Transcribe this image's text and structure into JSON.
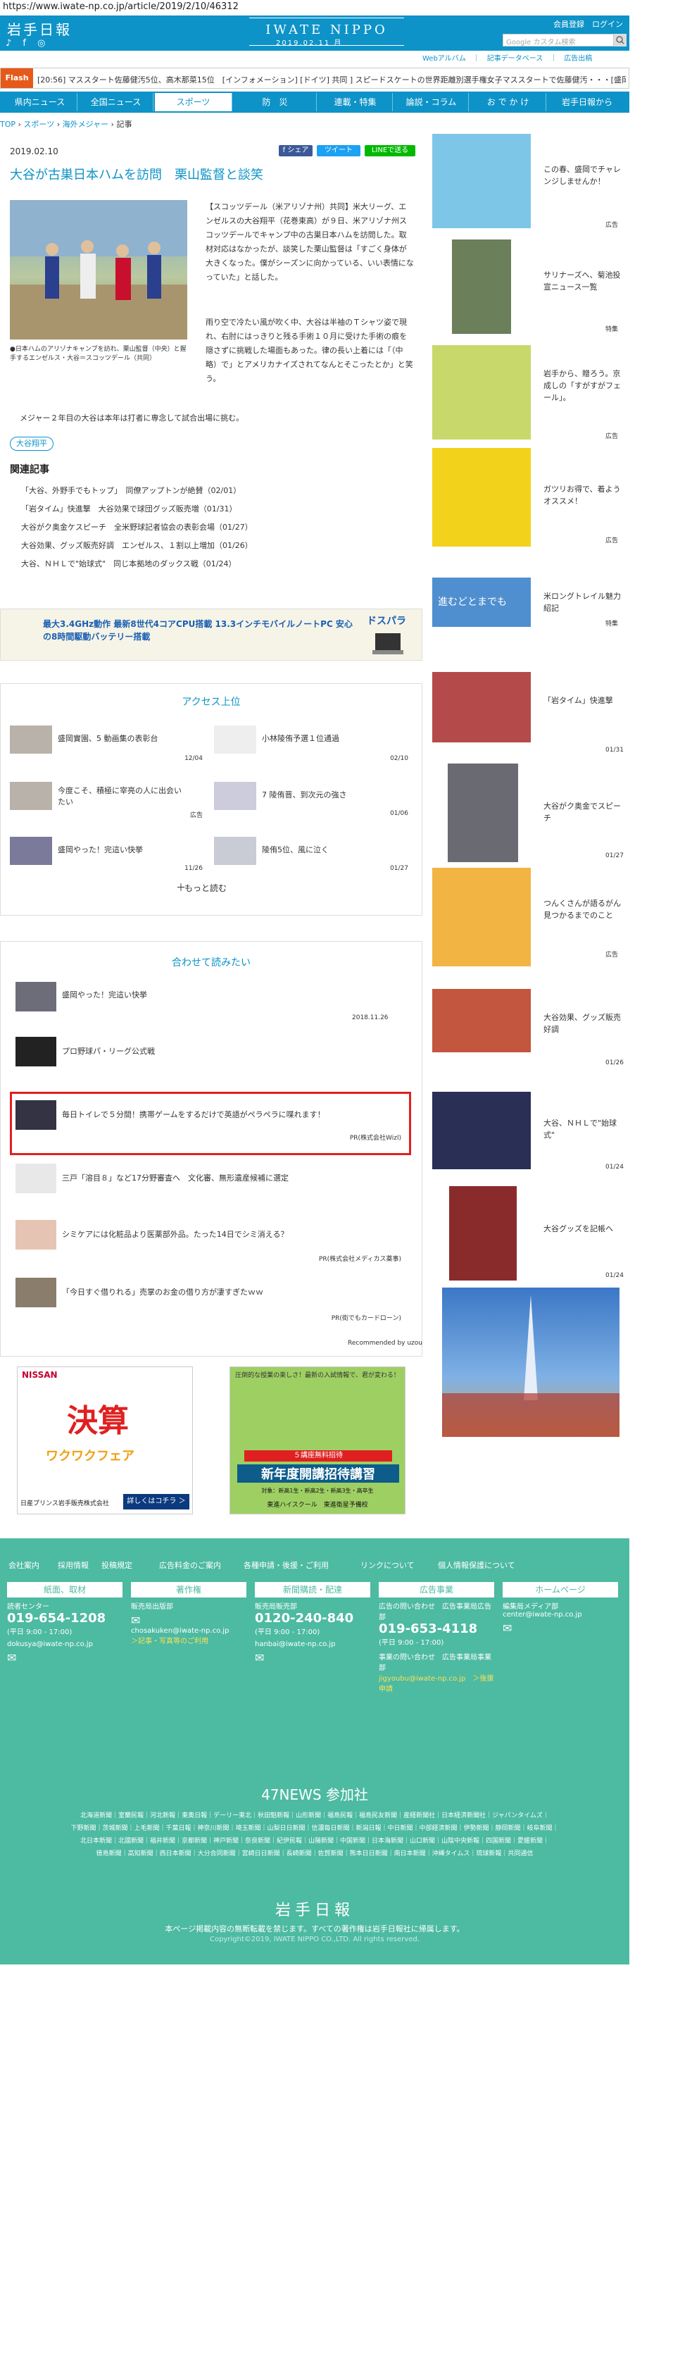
{
  "browser": {
    "url": "https://www.iwate-np.co.jp/article/2019/2/10/46312"
  },
  "header": {
    "logo": "岩手日報",
    "sns": "♪ f ◎",
    "brand": "IWATE NIPPO",
    "date": "2019.02.11 月",
    "links": "会員登録　ログイン",
    "search_placeholder": "Google カスタム検索",
    "webalbum": "Webアルバム　｜　記事データベース　｜　広告出稿"
  },
  "flash": {
    "label": "Flash",
    "text": "[20:56] マススタート佐藤健汚5位、高木那菜15位　[インフォメーション] [ドイツ] 共同 ] スピードスケートの世界距離別選手権女子マススタートで佐藤健汚・・・[盛岡・雫石] 盛岡市・・・"
  },
  "nav": [
    "県内ニュース",
    "全国ニュース",
    "スポーツ",
    "防　災",
    "連載・特集",
    "論説・コラム",
    "お で か け",
    "岩手日報から"
  ],
  "breadcrumb": {
    "top": "TOP",
    "sep": " › ",
    "sports": "スポーツ",
    "abroad": "海外メジャー",
    "current": "記事"
  },
  "article": {
    "date": "2019.02.10",
    "share_fb": "f シェア",
    "share_tw": "ツイート",
    "share_line": "LINEで送る",
    "headline": "大谷が古巣日本ハムを訪問　栗山監督と談笑",
    "caption": "●日本ハムのアリゾナキャンプを訪れ、栗山監督（中央）と握手するエンゼルス・大谷＝スコッツデール（共同）",
    "p1": "【スコッツデール（米アリゾナ州）共同】米大リーグ、エンゼルスの大谷翔平（花巻東高）が９日、米アリゾナ州スコッツデールでキャンプ中の古巣日本ハムを訪問した。取材対応はなかったが、談笑した栗山監督は「すごく身体が大きくなった。僕がシーズンに向かっている、いい表情になっていた」と話した。",
    "p2": "雨り空で冷たい風が吹く中、大谷は半袖のＴシャツ姿で現れ、右肘にはっきりと残る手術１０月に受けた手術の痕を隠さずに挑戦した場面もあった。律の長い上着には「（中略）で」とアメリカナイズされてなんとそこったとか」と笑う。",
    "p3": "メジャー２年目の大谷は本年は打者に専念して試合出場に挑む。",
    "tag": "大谷翔平",
    "related_title": "関連記事",
    "related": [
      "「大谷、外野手でもトップ」　同僚アップトンが絶賛（02/01）",
      "「岩タイム」快進撃　大谷効果で球団グッズ販売増（01/31）",
      "大谷がク奥金ケスピーチ　全米野球記者協会の表彰会場（01/27）",
      "大谷効果、グッズ販売好調　エンゼルス、１割以上増加（01/26）",
      "大谷、ＮＨＬで\"始球式\"　同じ本拠地のダックス戦（01/24）"
    ]
  },
  "banner": {
    "text": "最大3.4GHz動作 最新8世代4コアCPU搭載 13.3インチモバイルノートPC 安心の8時間駆動バッテリー搭載",
    "brand": "ドスパラ"
  },
  "ranking": {
    "title": "アクセス上位",
    "items": [
      {
        "title": "盛岡實園、5 動画集の表彰台",
        "date": "12/04"
      },
      {
        "title": "小林陵侑予選１位通過",
        "date": "02/10"
      },
      {
        "title": "今度こそ、積極に宰亮の人に出会いたい",
        "date": "広告"
      },
      {
        "title": "7 陵侑晋、到次元の強さ",
        "date": "01/06"
      },
      {
        "title": "盛岡やった！完這い快挙",
        "date": "11/26"
      },
      {
        "title": "陵侑5位、風に泣く",
        "date": "01/27"
      }
    ],
    "more": "もっと読む"
  },
  "recommend": {
    "title": "合わせて読みたい",
    "items": [
      {
        "title": "盛岡やった！完這い快挙",
        "date": "2018.11.26",
        "pr": ""
      },
      {
        "title": "プロ野球パ・リーグ公式戦",
        "date": "",
        "pr": ""
      },
      {
        "title": "毎日トイレで５分間！携帯ゲームをするだけで英語がペラペラに喋れます！",
        "date": "",
        "pr": "PR(株式会社Wizl)"
      },
      {
        "title": "三戸「溶目８」など17分野審査へ　文化審、無形遺産候補に選定",
        "date": "",
        "pr": ""
      },
      {
        "title": "シミケアには化粧品より医薬部外品。たった14日でシミ消える？",
        "date": "",
        "pr": "PR(株式会社メディカス薬事)"
      },
      {
        "title": "「今日すぐ借りれる」売掌のお金の借り方が凄すぎたｗｗ",
        "date": "",
        "pr": "PR(街でもカードローン)"
      }
    ],
    "reco": "Recommended by uzou"
  },
  "ads": {
    "nissan_brand": "NISSAN",
    "nissan_title": "決算",
    "nissan_sub": "ワクワクフェア",
    "nissan_dealer": "日産プリンス岩手販売株式会社",
    "nissan_cta": "詳しくはコチラ ＞",
    "school_top": "圧倒的な授業の楽しさ！最新の入試情報で、君が変わる！",
    "school_free": "５講座無料招待",
    "school_main": "新年度開講招待講習",
    "school_sub": "対象：新高1生・新高2生・新高3生・高卒生",
    "school_name": "東進ハイスクール　東進衛星予備校"
  },
  "sidebar": [
    {
      "text": "この春、盛岡でチャレンジしませんか！",
      "meta": "広告"
    },
    {
      "text": "サリナーズへ、菊池投宣ニュース一覧",
      "meta": "特集"
    },
    {
      "text": "岩手から、贈ろう。京成しの「すがすがフェール」。",
      "meta": "広告"
    },
    {
      "text": "ガツリお得で、着ようオススメ！",
      "meta": "広告"
    },
    {
      "text": "米ロングトレイル魅力紹記",
      "meta": "特集"
    },
    {
      "text": "「岩タイム」快進撃",
      "meta": "01/31"
    },
    {
      "text": "大谷がク奥金でスピーチ",
      "meta": "01/27"
    },
    {
      "text": "つんくさんが語るがん見つかるまでのこと",
      "meta": "広告"
    },
    {
      "text": "大谷効果、グッズ販売好調",
      "meta": "01/26"
    },
    {
      "text": "大谷、ＮＨＬで\"始球式\"",
      "meta": "01/24"
    },
    {
      "text": "大谷グッズを記帳へ",
      "meta": "01/24"
    }
  ],
  "sidebar_banner": {
    "text": "進むどとまでも"
  },
  "footer": {
    "links": [
      "会社案内",
      "採用情報",
      "投稿規定",
      "広告料金のご案内",
      "各種申請・後援・ご利用",
      "リンクについて",
      "個人情報保護について"
    ],
    "cols": [
      {
        "h": "紙面、取材",
        "l1": "読者センター",
        "tel": "019-654-1208",
        "hours": "(平日 9:00 - 17:00)",
        "mail": "dokusya@iwate-np.co.jp",
        "extra": ""
      },
      {
        "h": "著作権",
        "l1": "販売局出版部",
        "tel": "",
        "hours": "",
        "mail": "chosakuken@iwate-np.co.jp",
        "extra": "＞記事・写真等のご利用"
      },
      {
        "h": "新聞購読・配達",
        "l1": "販売局販売部",
        "tel": "0120-240-840",
        "hours": "(平日 9:00 - 17:00)",
        "mail": "hanbai@iwate-np.co.jp",
        "extra": ""
      },
      {
        "h": "広告事業",
        "l1": "広告の問い合わせ　広告事業局広告部",
        "tel": "019-653-4118",
        "hours": "(平日 9:00 - 17:00)",
        "mail": "事業の問い合わせ　広告事業局事業部",
        "extra": "jigyoubu@iwate-np.co.jp　＞後援申請"
      },
      {
        "h": "ホームページ",
        "l1": "編集局メディア部",
        "tel": "",
        "hours": "",
        "mail": "center@iwate-np.co.jp",
        "extra": ""
      }
    ],
    "news47": "47NEWS 参加社",
    "papers1": "北海道新聞｜室蘭民報｜河北新報｜東奥日報｜デーリー東北｜秋田魁新報｜山形新聞｜福島民報｜福島民友新聞｜産経新聞社｜日本経済新聞社｜ジャパンタイムズ｜",
    "papers2": "下野新聞｜茨城新聞｜上毛新聞｜千葉日報｜神奈川新聞｜埼玉新聞｜山梨日日新聞｜信濃毎日新聞｜新潟日報｜中日新聞｜中部経済新聞｜伊勢新聞｜静岡新聞｜岐阜新聞｜",
    "papers3": "北日本新聞｜北國新聞｜福井新聞｜京都新聞｜神戸新聞｜奈良新聞｜紀伊民報｜山陽新聞｜中国新聞｜日本海新聞｜山口新聞｜山陰中央新報｜四国新聞｜愛媛新聞｜",
    "papers4": "徳島新聞｜高知新聞｜西日本新聞｜大分合同新聞｜宮崎日日新聞｜長崎新聞｜佐賀新聞｜熊本日日新聞｜南日本新聞｜沖縄タイムス｜琉球新報｜共同通信",
    "logo": "岩手日報",
    "note": "本ページ掲載内容の無断転載を禁じます。すべての著作権は岩手日報社に帰属します。",
    "copy": "Copyright©2019, IWATE NIPPO CO.,LTD. All rights reserved."
  }
}
